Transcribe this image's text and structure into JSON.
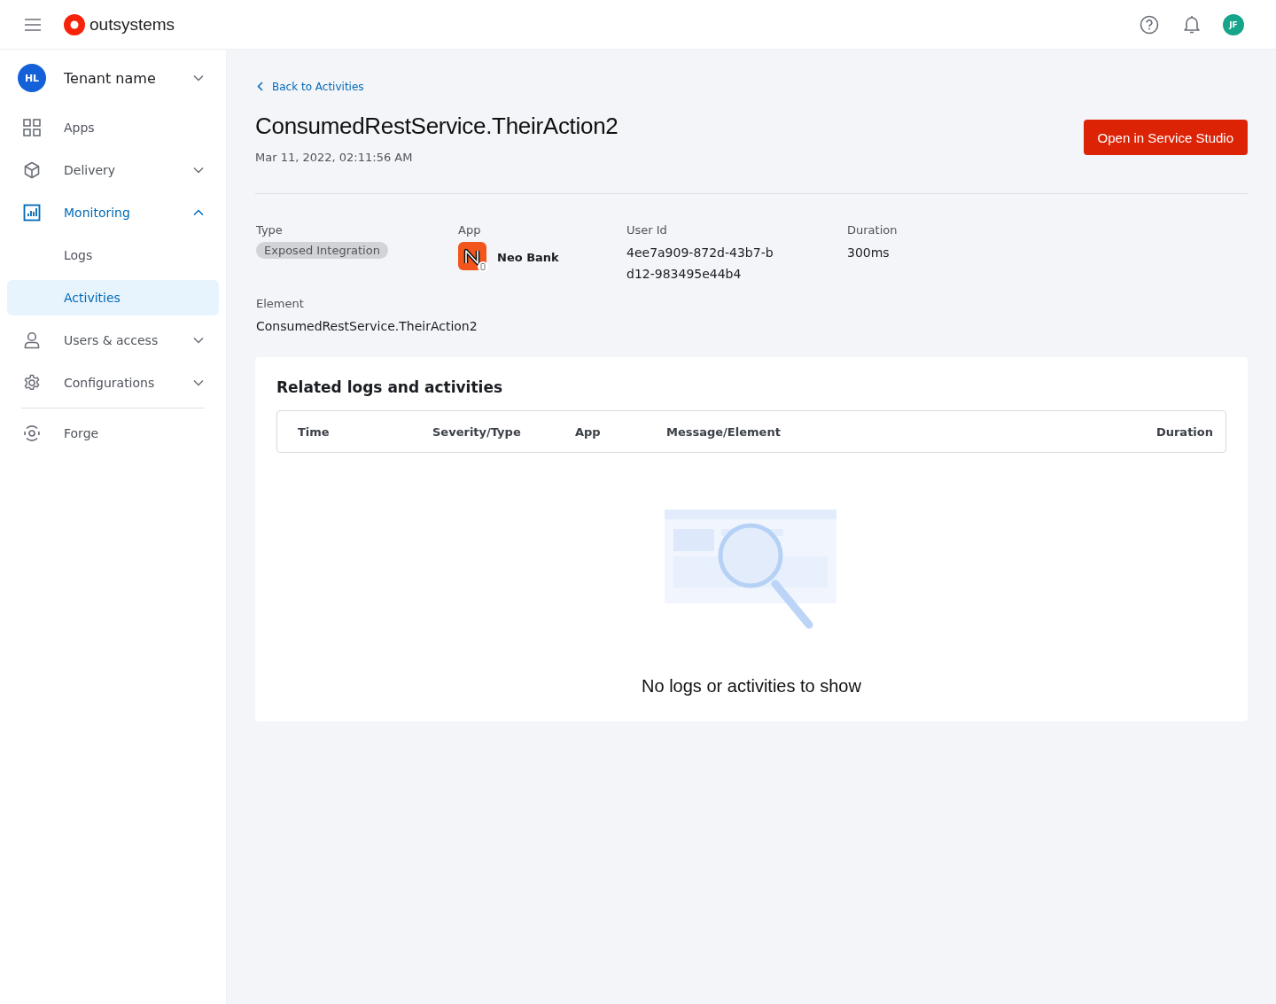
{
  "header": {
    "logo": "outsystems",
    "avatar": "JF"
  },
  "sidebar": {
    "tenant": {
      "initials": "HL",
      "name": "Tenant name"
    },
    "items": [
      {
        "label": "Apps",
        "selected": false
      },
      {
        "label": "Delivery",
        "selected": false,
        "expanded": false
      },
      {
        "label": "Monitoring",
        "selected": true,
        "expanded": true,
        "children": [
          {
            "label": "Logs",
            "selected": false
          },
          {
            "label": "Activities",
            "selected": true
          }
        ]
      },
      {
        "label": "Users & access",
        "selected": false,
        "expanded": false
      },
      {
        "label": "Configurations",
        "selected": false,
        "expanded": false
      },
      {
        "label": "Forge",
        "selected": false
      }
    ]
  },
  "back_link": "Back to Activities",
  "title": "ConsumedRestService.TheirAction2",
  "timestamp": "Mar 11, 2022, 02:11:56 AM",
  "primary_button": "Open in Service Studio",
  "details": {
    "type_label": "Type",
    "type_value": "Exposed Integration",
    "app_label": "App",
    "app_value": "Neo Bank",
    "user_label": "User Id",
    "user_value": "4ee7a909-872d-43b7-bd12-983495e44b4",
    "duration_label": "Duration",
    "duration_value": "300ms",
    "element_label": "Element",
    "element_value": "ConsumedRestService.TheirAction2"
  },
  "related": {
    "title": "Related logs and activities",
    "columns": [
      "Time",
      "Severity/Type",
      "App",
      "Message/Element",
      "Duration"
    ],
    "empty_message": "No logs or activities to show"
  }
}
